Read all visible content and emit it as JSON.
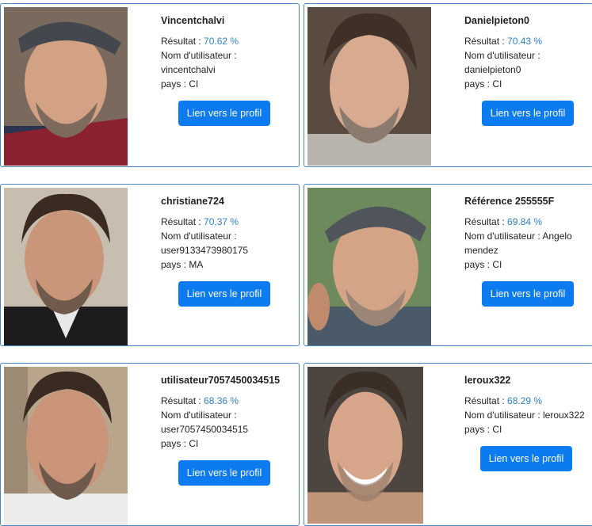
{
  "labels": {
    "result": "Résultat : ",
    "username": "Nom d'utilisateur :",
    "username_inline": "Nom d'utilisateur : ",
    "country": "pays : ",
    "button": "Lien vers le profil"
  },
  "cards": [
    {
      "title": "Vincentchalvi",
      "result": "70.62 %",
      "username": "vincentchalvi",
      "country": "CI"
    },
    {
      "title": "Danielpieton0",
      "result": "70.43 %",
      "username": "danielpieton0",
      "country": "CI"
    },
    {
      "title": "christiane724",
      "result": "70,37 %",
      "username": "user9133473980175",
      "country": "MA"
    },
    {
      "title": "Référence 255555F",
      "result": "69.84 %",
      "username_inline_1": "Angelo",
      "username_inline_2": "mendez",
      "country": "CI"
    },
    {
      "title": "utilisateur7057450034515",
      "result": "68.36 %",
      "username": "user7057450034515",
      "country": "CI"
    },
    {
      "title": "leroux322",
      "result": "68.29 %",
      "username_inline": "leroux322",
      "country": "CI"
    }
  ],
  "icons": {
    "photo": "profile-photo"
  },
  "colors": {
    "card_border": "#4a86c5",
    "button_bg": "#0d7bf0",
    "percent_text": "#2f80c9"
  }
}
